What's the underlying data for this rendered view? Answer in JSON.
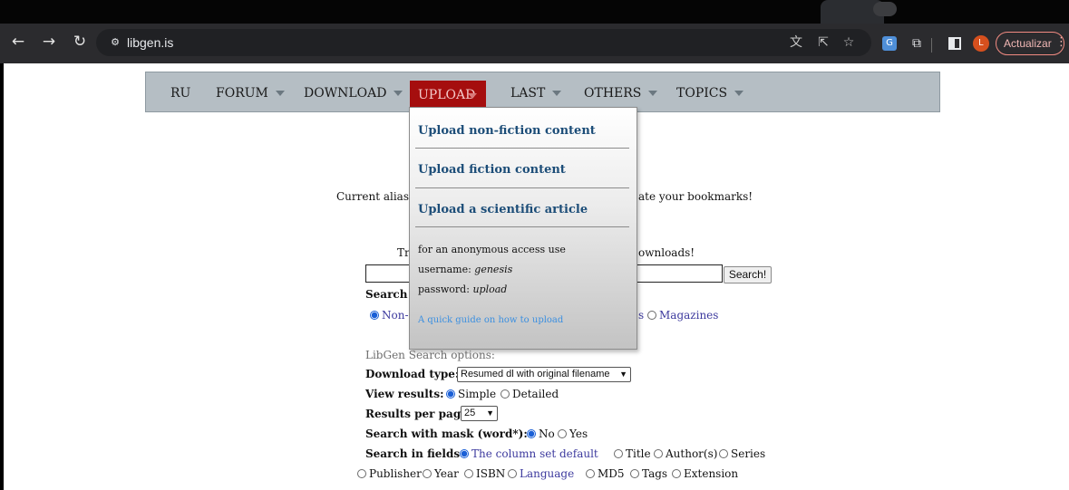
{
  "browser": {
    "url": "libgen.is",
    "update_label": "Actualizar",
    "avatar_letter": "L"
  },
  "menu": {
    "items": [
      "RU",
      "FORUM",
      "DOWNLOAD",
      "UPLOAD",
      "LAST",
      "OTHERS",
      "TOPICS"
    ],
    "active": "UPLOAD"
  },
  "upload_dropdown": {
    "link_nonfiction": "Upload non-fiction content",
    "link_fiction": "Upload fiction content",
    "link_article": "Upload a scientific article",
    "note_line1": "for an anonymous access use",
    "username_label": "username:",
    "username_value": "genesis",
    "password_label": "password:",
    "password_value": "upload",
    "guide_link": "A quick guide on how to upload"
  },
  "page": {
    "alias_left": "Current alias",
    "alias_right": "ate your bookmarks!",
    "tr_left": "Tr",
    "tr_right": "ownloads!",
    "search_button": "Search!",
    "search_in_left": "Search i",
    "nonfiction_partial": "Non-",
    "cat_tail": "s",
    "magazines": "Magazines",
    "options_heading": "LibGen Search options:",
    "download_type_label": "Download type:",
    "download_type_value": "Resumed dl with original filename",
    "view_results_label": "View results:",
    "view_simple": "Simple",
    "view_detailed": "Detailed",
    "per_page_label": "Results per page",
    "per_page_value": "25",
    "mask_label": "Search with mask (word*):",
    "mask_no": "No",
    "mask_yes": "Yes",
    "fields_label": "Search in fields",
    "fields_default": "The column set default",
    "fields_title": "Title",
    "fields_author": "Author(s)",
    "fields_series": "Series",
    "fields_publisher": "Publisher",
    "fields_year": "Year",
    "fields_isbn": "ISBN",
    "fields_language": "Language",
    "fields_md5": "MD5",
    "fields_tags": "Tags",
    "fields_extension": "Extension"
  },
  "colors": {
    "menubar": "#b5bec4",
    "upload_active": "#a50e0e",
    "dropdown_link": "#1c4d78"
  }
}
